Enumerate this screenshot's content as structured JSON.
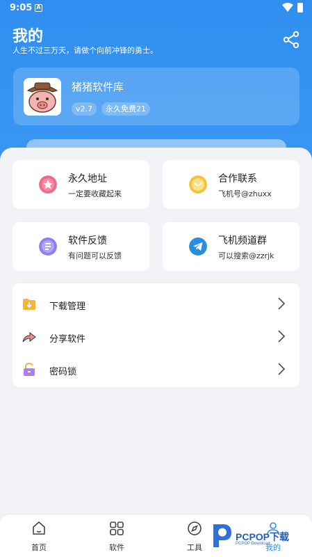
{
  "status": {
    "time": "9:05"
  },
  "header": {
    "title": "我的",
    "subtitle": "人生不过三万天，请做个向前冲锋的勇士。"
  },
  "profile": {
    "app_name": "猪猪软件库",
    "version": "v2.7",
    "plan": "永久免费21"
  },
  "tiles": [
    {
      "title": "永久地址",
      "subtitle": "一定要收藏起来",
      "icon": "star-icon",
      "color": "#f06a8c"
    },
    {
      "title": "合作联系",
      "subtitle": "飞机号@zhuxx",
      "icon": "chat-icon",
      "color": "#f5c23a"
    },
    {
      "title": "软件反馈",
      "subtitle": "有问题可以反馈",
      "icon": "feedback-icon",
      "color": "#8e7ef0"
    },
    {
      "title": "飞机频道群",
      "subtitle": "可以搜索@zzrjk",
      "icon": "telegram-icon",
      "color": "#2a8ee0"
    }
  ],
  "menu": [
    {
      "label": "下载管理",
      "icon": "download-folder-icon",
      "color": "#f5b53a"
    },
    {
      "label": "分享软件",
      "icon": "share-arrow-icon",
      "color": "#f08a8a"
    },
    {
      "label": "密码锁",
      "icon": "lock-icon",
      "color": "#b07ef0"
    }
  ],
  "tabbar": [
    {
      "label": "首页",
      "icon": "home-icon"
    },
    {
      "label": "软件",
      "icon": "grid-icon"
    },
    {
      "label": "工具",
      "icon": "compass-icon"
    },
    {
      "label": "我的",
      "icon": "user-icon",
      "active": true
    }
  ],
  "watermark": {
    "brand": "PCPOP下载",
    "sub": "PCPOP Download"
  }
}
